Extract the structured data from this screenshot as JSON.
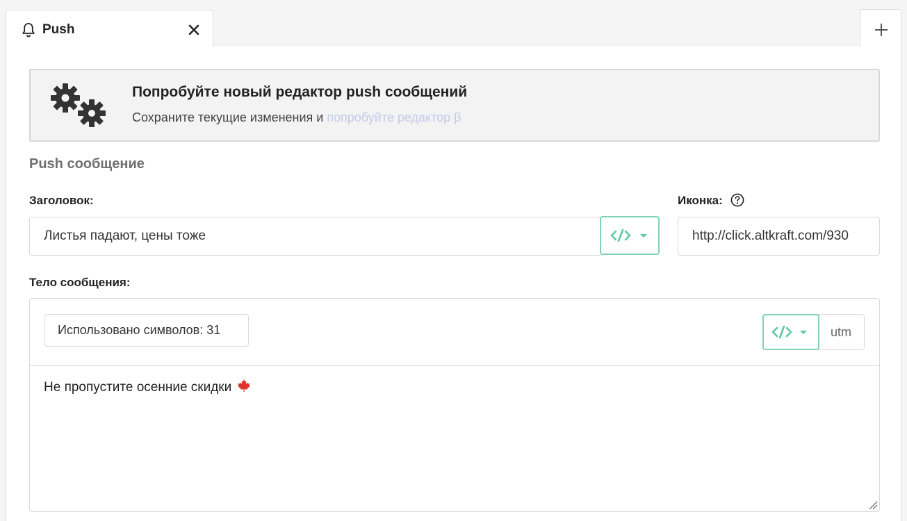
{
  "tabs": {
    "active_tab_label": "Push",
    "add_tab_icon": "plus-icon",
    "close_icon": "close-icon"
  },
  "banner": {
    "title": "Попробуйте новый редактор push сообщений",
    "text": "Сохраните текущие изменения и ",
    "link_text": "попробуйте редактор β",
    "icon": "gears-icon"
  },
  "section": {
    "title": "Push сообщение"
  },
  "title_field": {
    "label": "Заголовок:",
    "value": "Листья падают, цены тоже"
  },
  "icon_field": {
    "label": "Иконка:",
    "value": "http://click.altkraft.com/930"
  },
  "body": {
    "label": "Тело сообщения:",
    "char_counter": "Использовано символов: 31",
    "utm_label": "utm",
    "text": "Не пропустите осенние скидки",
    "emoji": "maple-leaf-icon"
  },
  "colors": {
    "accent": "#5cc8a0",
    "link": "#c5cae9",
    "maple_leaf": "#e0322d"
  }
}
